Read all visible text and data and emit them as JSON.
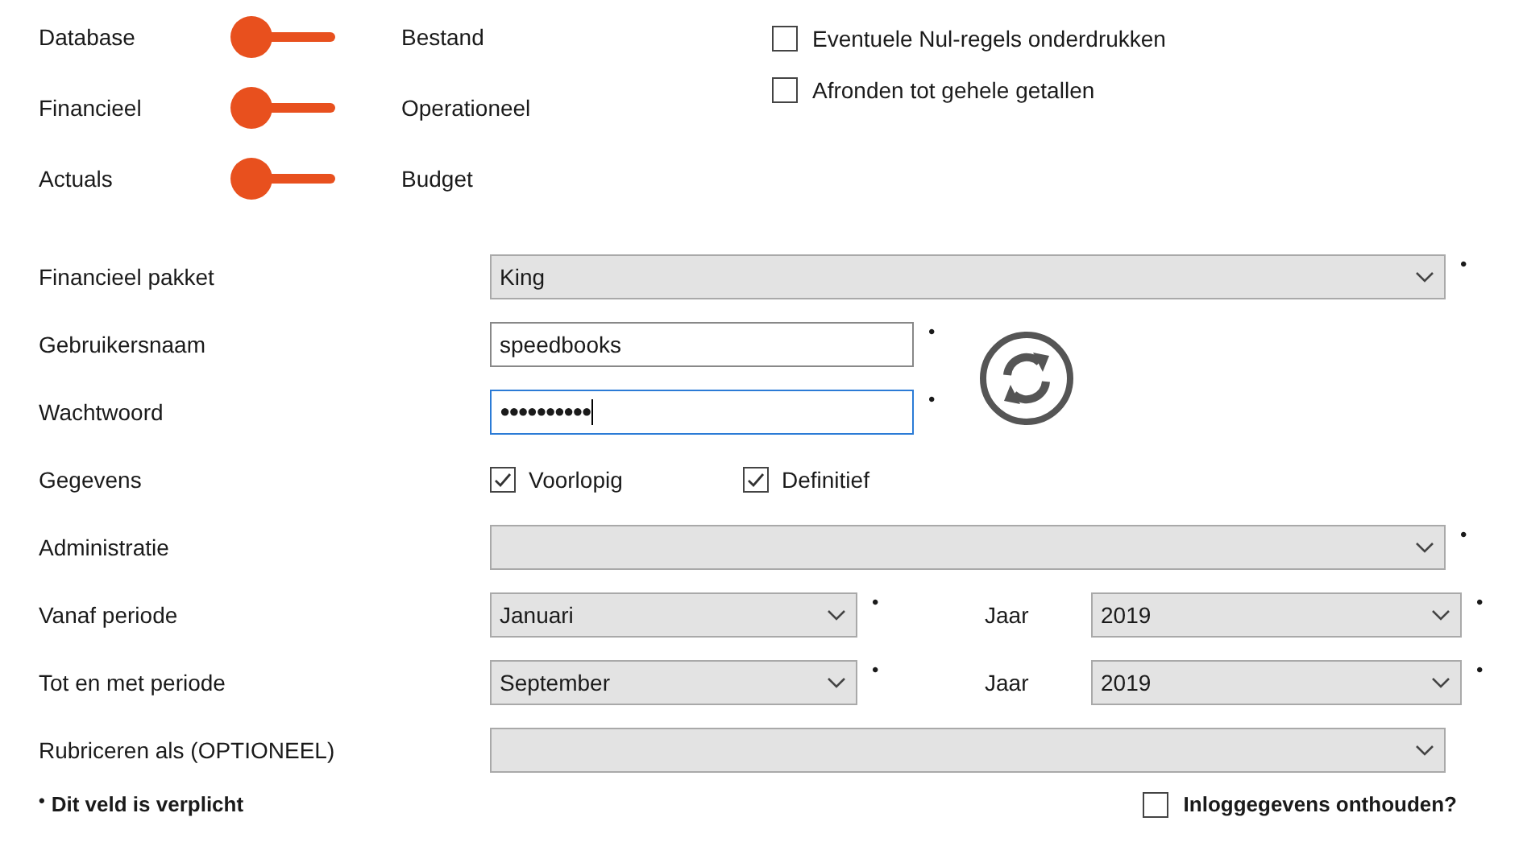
{
  "toggles": [
    {
      "left": "Database",
      "right": "Bestand",
      "on": false
    },
    {
      "left": "Financieel",
      "right": "Operationeel",
      "on": false
    },
    {
      "left": "Actuals",
      "right": "Budget",
      "on": false
    }
  ],
  "options": [
    {
      "label": "Eventuele Nul-regels onderdrukken",
      "checked": false
    },
    {
      "label": "Afronden tot gehele getallen",
      "checked": false
    }
  ],
  "form": {
    "rows": [
      {
        "kind": "select",
        "label": "Financieel pakket",
        "value": "King",
        "required_mark": "•"
      },
      {
        "kind": "input",
        "label": "Gebruikersnaam",
        "value": "speedbooks",
        "required_mark": "•",
        "focused": false
      },
      {
        "kind": "input",
        "label": "Wachtwoord",
        "value": "●●●●●●●●●●",
        "required_mark": "•",
        "focused": true
      },
      {
        "kind": "checks",
        "label": "Gegevens",
        "items": [
          {
            "label": "Voorlopig",
            "checked": true
          },
          {
            "label": "Definitief",
            "checked": true
          }
        ]
      },
      {
        "kind": "select",
        "label": "Administratie",
        "required_mark": "•"
      },
      {
        "kind": "period",
        "label": "Vanaf periode",
        "value": "Januari",
        "required_mark": "•",
        "year_label": "Jaar",
        "year": "2019",
        "year_required_mark": "•"
      },
      {
        "kind": "period",
        "label": "Tot en met periode",
        "value": "September",
        "required_mark": "•",
        "year_label": "Jaar",
        "year": "2019",
        "year_required_mark": "•"
      },
      {
        "kind": "select",
        "label": "Rubriceren als (OPTIONEEL)"
      }
    ]
  },
  "footer": {
    "note_mark": "•",
    "note": "Dit veld is verplicht",
    "remember": {
      "label": "Inloggegevens onthouden?",
      "checked": false
    }
  }
}
